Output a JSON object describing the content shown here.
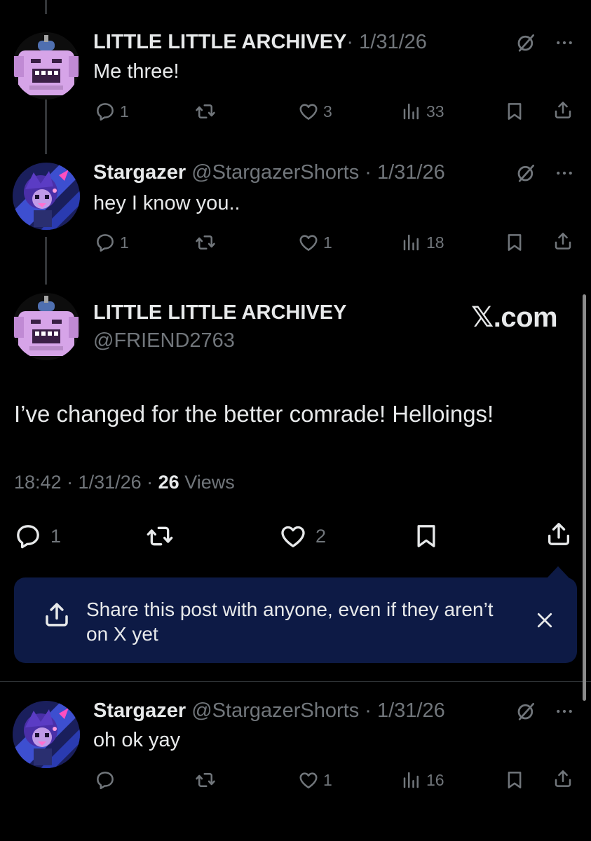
{
  "posts": [
    {
      "name": "LITTLE LITTLE ARCHIVEY",
      "handle": "",
      "meta": "· 1/31/26",
      "text": "Me three!",
      "reply_count": "1",
      "like_count": "3",
      "view_count": "33",
      "avatar": "robot-avatar"
    },
    {
      "name": "Stargazer",
      "handle": "@StargazerShorts",
      "meta": " @StargazerShorts · 1/31/26",
      "text": "hey I know you..",
      "reply_count": "1",
      "like_count": "1",
      "view_count": "18",
      "avatar": "stargazer-avatar"
    },
    {
      "name": "Stargazer",
      "handle": "@StargazerShorts",
      "meta": " @StargazerShorts · 1/31/26",
      "text": "oh ok yay",
      "reply_count": "",
      "like_count": "1",
      "view_count": "16",
      "avatar": "stargazer-avatar"
    }
  ],
  "main_post": {
    "name": "LITTLE LITTLE ARCHIVEY",
    "handle": "@FRIEND2763",
    "watermark": "𝕏.com",
    "text": "I’ve changed for the better comrade! Helloings!",
    "time_date": "18:42 · 1/31/26 · ",
    "views_count": "26",
    "views_label": " Views",
    "reply_count": "1",
    "like_count": "2"
  },
  "share_banner": {
    "text": "Share this post with anyone, even if they aren’t on X yet"
  },
  "colors": {
    "background": "#000000",
    "text": "#e7e9ea",
    "muted": "#71767b",
    "banner": "#0d1a45"
  },
  "icons": [
    "grok-icon",
    "more-icon",
    "reply-icon",
    "repost-icon",
    "like-icon",
    "views-icon",
    "bookmark-icon",
    "share-icon",
    "close-icon"
  ]
}
